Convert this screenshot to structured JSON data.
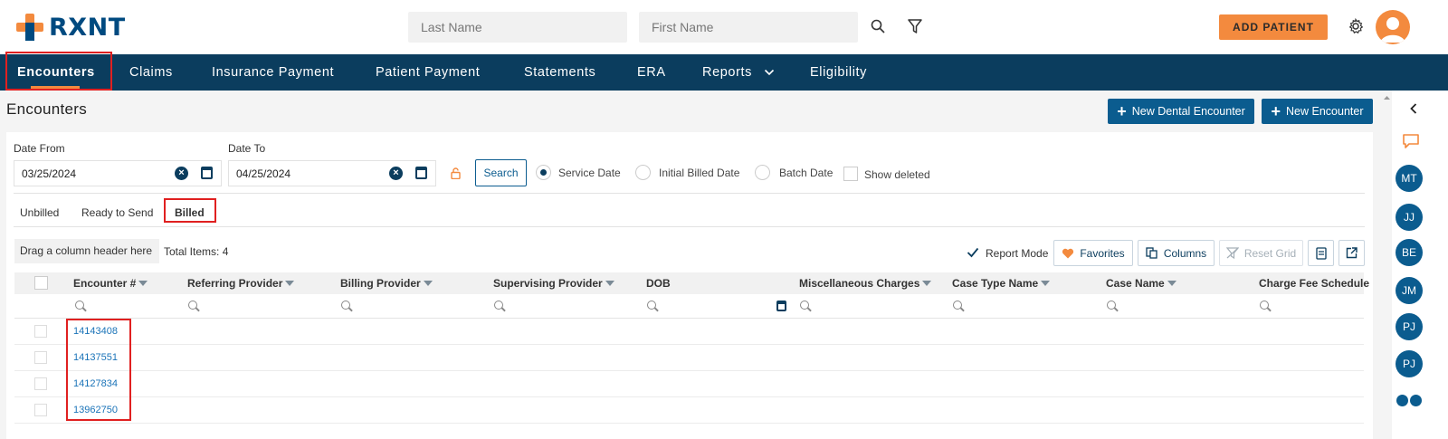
{
  "app": {
    "logo_text": "RXNT"
  },
  "header": {
    "last_name_placeholder": "Last Name",
    "first_name_placeholder": "First Name",
    "add_patient_label": "ADD PATIENT"
  },
  "nav": {
    "items": [
      {
        "label": "Encounters",
        "active": true
      },
      {
        "label": "Claims"
      },
      {
        "label": "Insurance Payment"
      },
      {
        "label": "Patient Payment"
      },
      {
        "label": "Statements"
      },
      {
        "label": "ERA"
      },
      {
        "label": "Reports"
      },
      {
        "label": "Eligibility"
      }
    ]
  },
  "page": {
    "title": "Encounters",
    "new_dental_label": "New Dental Encounter",
    "new_encounter_label": "New Encounter"
  },
  "filters": {
    "date_from_label": "Date From",
    "date_from_value": "03/25/2024",
    "date_to_label": "Date To",
    "date_to_value": "04/25/2024",
    "search_label": "Search",
    "radio_service": "Service Date",
    "radio_initial": "Initial Billed Date",
    "radio_batch": "Batch Date",
    "show_deleted": "Show deleted"
  },
  "tabs": [
    {
      "label": "Unbilled"
    },
    {
      "label": "Ready to Send"
    },
    {
      "label": "Billed",
      "active": true
    }
  ],
  "grid": {
    "drag_hint": "Drag a column header here",
    "total_items": "Total Items: 4",
    "report_mode": "Report Mode",
    "favorites": "Favorites",
    "columns": "Columns",
    "reset_grid": "Reset Grid",
    "headers": [
      "Encounter #",
      "Referring Provider",
      "Billing Provider",
      "Supervising Provider",
      "DOB",
      "Miscellaneous Charges",
      "Case Type Name",
      "Case Name",
      "Charge Fee Schedule"
    ],
    "rows": [
      "14143408",
      "14137551",
      "14127834",
      "13962750"
    ]
  },
  "rail": {
    "initials": [
      "MT",
      "JJ",
      "BE",
      "JM",
      "PJ",
      "PJ"
    ]
  },
  "colors": {
    "nav_bg": "#0b3d5e",
    "accent": "#f38a3e",
    "primary_btn": "#0b5c8f",
    "link": "#1a73b8"
  }
}
